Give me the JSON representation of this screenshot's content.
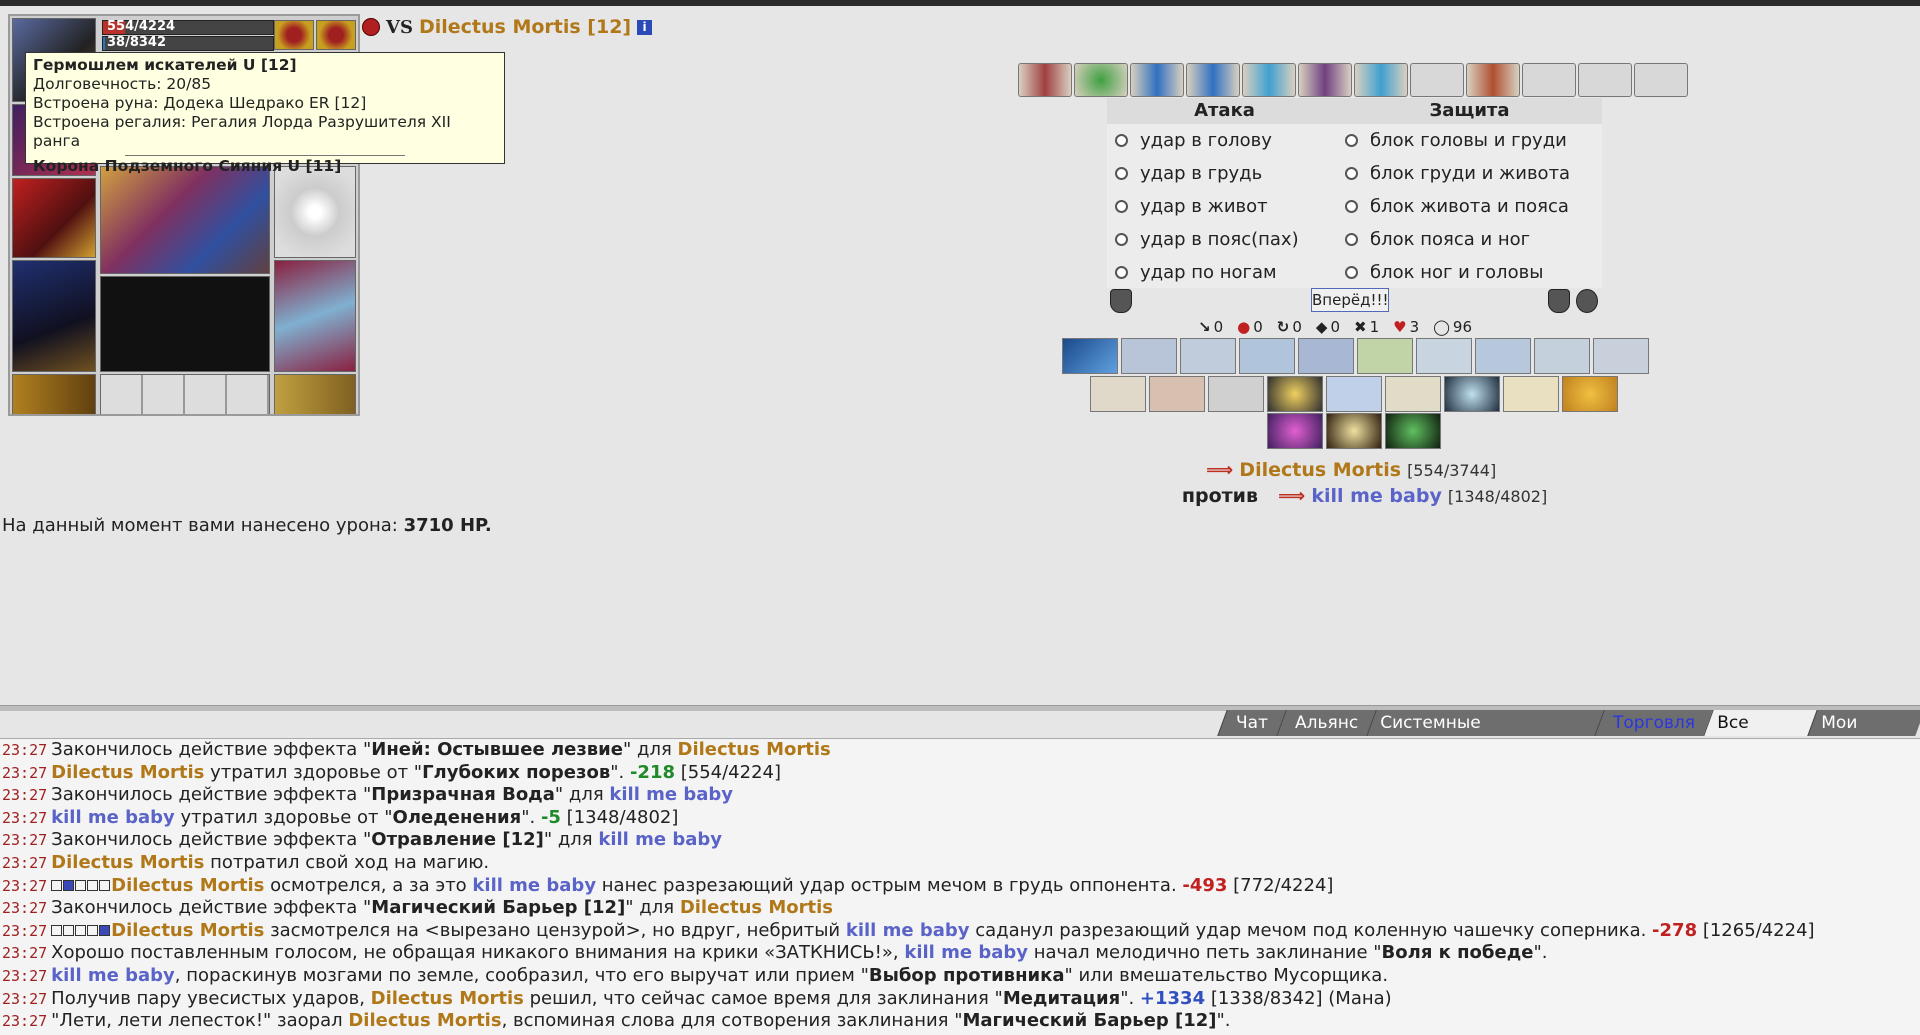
{
  "character": {
    "hp_text": "554/4224",
    "mp_text": "38/8342",
    "hp_fraction": 0.131,
    "mp_fraction": 0.005
  },
  "tooltip": {
    "title": "Гермошлем искателей U [12]",
    "durability": "Долговечность: 20/85",
    "rune": "Встроена руна: Додека Шедрако ER [12]",
    "regalia": "Встроена регалия: Регалия Лорда Разрушителя XII ранга",
    "second_item": "Корона Подземного Сияния U [11]"
  },
  "header": {
    "vs": "VS",
    "name": "Dilectus Mortis [12]",
    "info": "i"
  },
  "attack": {
    "title": "Атака",
    "options": [
      "удар в голову",
      "удар в грудь",
      "удар в живот",
      "удар в пояс(пах)",
      "удар по ногам"
    ]
  },
  "defense": {
    "title": "Защита",
    "options": [
      "блок головы и груди",
      "блок груди и живота",
      "блок живота и пояса",
      "блок пояса и ног",
      "блок ног и головы"
    ]
  },
  "forward_button": "Вперёд!!!",
  "stats": [
    {
      "icon": "sword-icon",
      "glyph": "↘",
      "value": "0"
    },
    {
      "icon": "blood-icon",
      "glyph": "●",
      "value": "0"
    },
    {
      "icon": "counter-icon",
      "glyph": "↻",
      "value": "0"
    },
    {
      "icon": "shield-icon",
      "glyph": "◆",
      "value": "0"
    },
    {
      "icon": "crossed-swords-icon",
      "glyph": "✖",
      "value": "1"
    },
    {
      "icon": "heart-icon",
      "glyph": "♥",
      "value": "3"
    },
    {
      "icon": "armor-icon",
      "glyph": "◯",
      "value": "96"
    }
  ],
  "fighters": {
    "player_name": "Dilectus Mortis",
    "player_hp": "[554/3744]",
    "versus": "против",
    "enemy_name": "kill me baby",
    "enemy_hp": "[1348/4802]"
  },
  "damage": {
    "label": "На данный момент вами нанесено урона:",
    "value": "3710 HP."
  },
  "tabs": [
    "Чат",
    "Альянс",
    "Системные сообщения",
    "Торговля",
    "Все логи",
    "Мои логи"
  ],
  "log": {
    "time": "23:27",
    "lines": [
      {
        "a": "Закончилось действие эффекта \"",
        "b": "Иней: Остывшее лезвие",
        "c": "\" для ",
        "who": "Dilectus Mortis"
      },
      {
        "who": "Dilectus Mortis",
        "a": " утратил здоровье от \"",
        "b": "Глубоких порезов",
        "c": "\". ",
        "num": "-218",
        "tail": " [554/4224]"
      },
      {
        "a": "Закончилось действие эффекта \"",
        "b": "Призрачная Вода",
        "c": "\" для ",
        "who": "kill me baby"
      },
      {
        "who": "kill me baby",
        "a": " утратил здоровье от \"",
        "b": "Оледенения",
        "c": "\". ",
        "num": "-5",
        "tail": " [1348/4802]"
      },
      {
        "a": "Закончилось действие эффекта \"",
        "b": "Отравление [12]",
        "c": "\" для ",
        "who": "kill me baby"
      },
      {
        "who": "Dilectus Mortis",
        "a": " потратил свой ход на магию."
      },
      {
        "who": "Dilectus Mortis",
        "a": " осмотрелся, а за это ",
        "who2": "kill me baby",
        "c": " нанес разрезающий удар острым мечом в грудь оппонента. ",
        "num": "-493",
        "tail": " [772/4224]"
      },
      {
        "a": "Закончилось действие эффекта \"",
        "b": "Магический Барьер [12]",
        "c": "\" для ",
        "who": "Dilectus Mortis"
      },
      {
        "who": "Dilectus Mortis",
        "a": " засмотрелся на <вырезано цензурой>, но вдруг, небритый ",
        "who2": "kill me baby",
        "c": " саданул разрезающий удар мечом под коленную чашечку соперника. ",
        "num": "-278",
        "tail": " [1265/4224]"
      },
      {
        "a": "Хорошо поставленным голосом, не обращая никакого внимания на крики «ЗАТКНИСЬ!», ",
        "who": "kill me baby",
        "c": " начал мелодично петь заклинание \"",
        "b": "Воля к победе",
        "tail": "\"."
      },
      {
        "who": "kill me baby",
        "a": ", пораскинув мозгами по земле, сообразил, что его выручат или прием \"",
        "b": "Выбор противника",
        "c": "\" или вмешательство Мусорщика."
      },
      {
        "a": "Получив пару увесистых ударов, ",
        "who": "Dilectus Mortis",
        "c": " решил, что сейчас самое время для заклинания \"",
        "b": "Медитация",
        "c2": "\". ",
        "mana": "+1334",
        "tail": " [1338/8342] (Мана)"
      },
      {
        "a": "\"Лети, лети лепесток!\" заорал ",
        "who": "Dilectus Mortis",
        "c": ", вспоминая слова для сотворения заклинания \"",
        "b": "Магический Барьер [12]",
        "tail": "\"."
      }
    ]
  },
  "colors": {
    "gold": "#b07818",
    "blue": "#5a63c8",
    "damage": "#c02020",
    "heal": "#1f8a2a"
  }
}
